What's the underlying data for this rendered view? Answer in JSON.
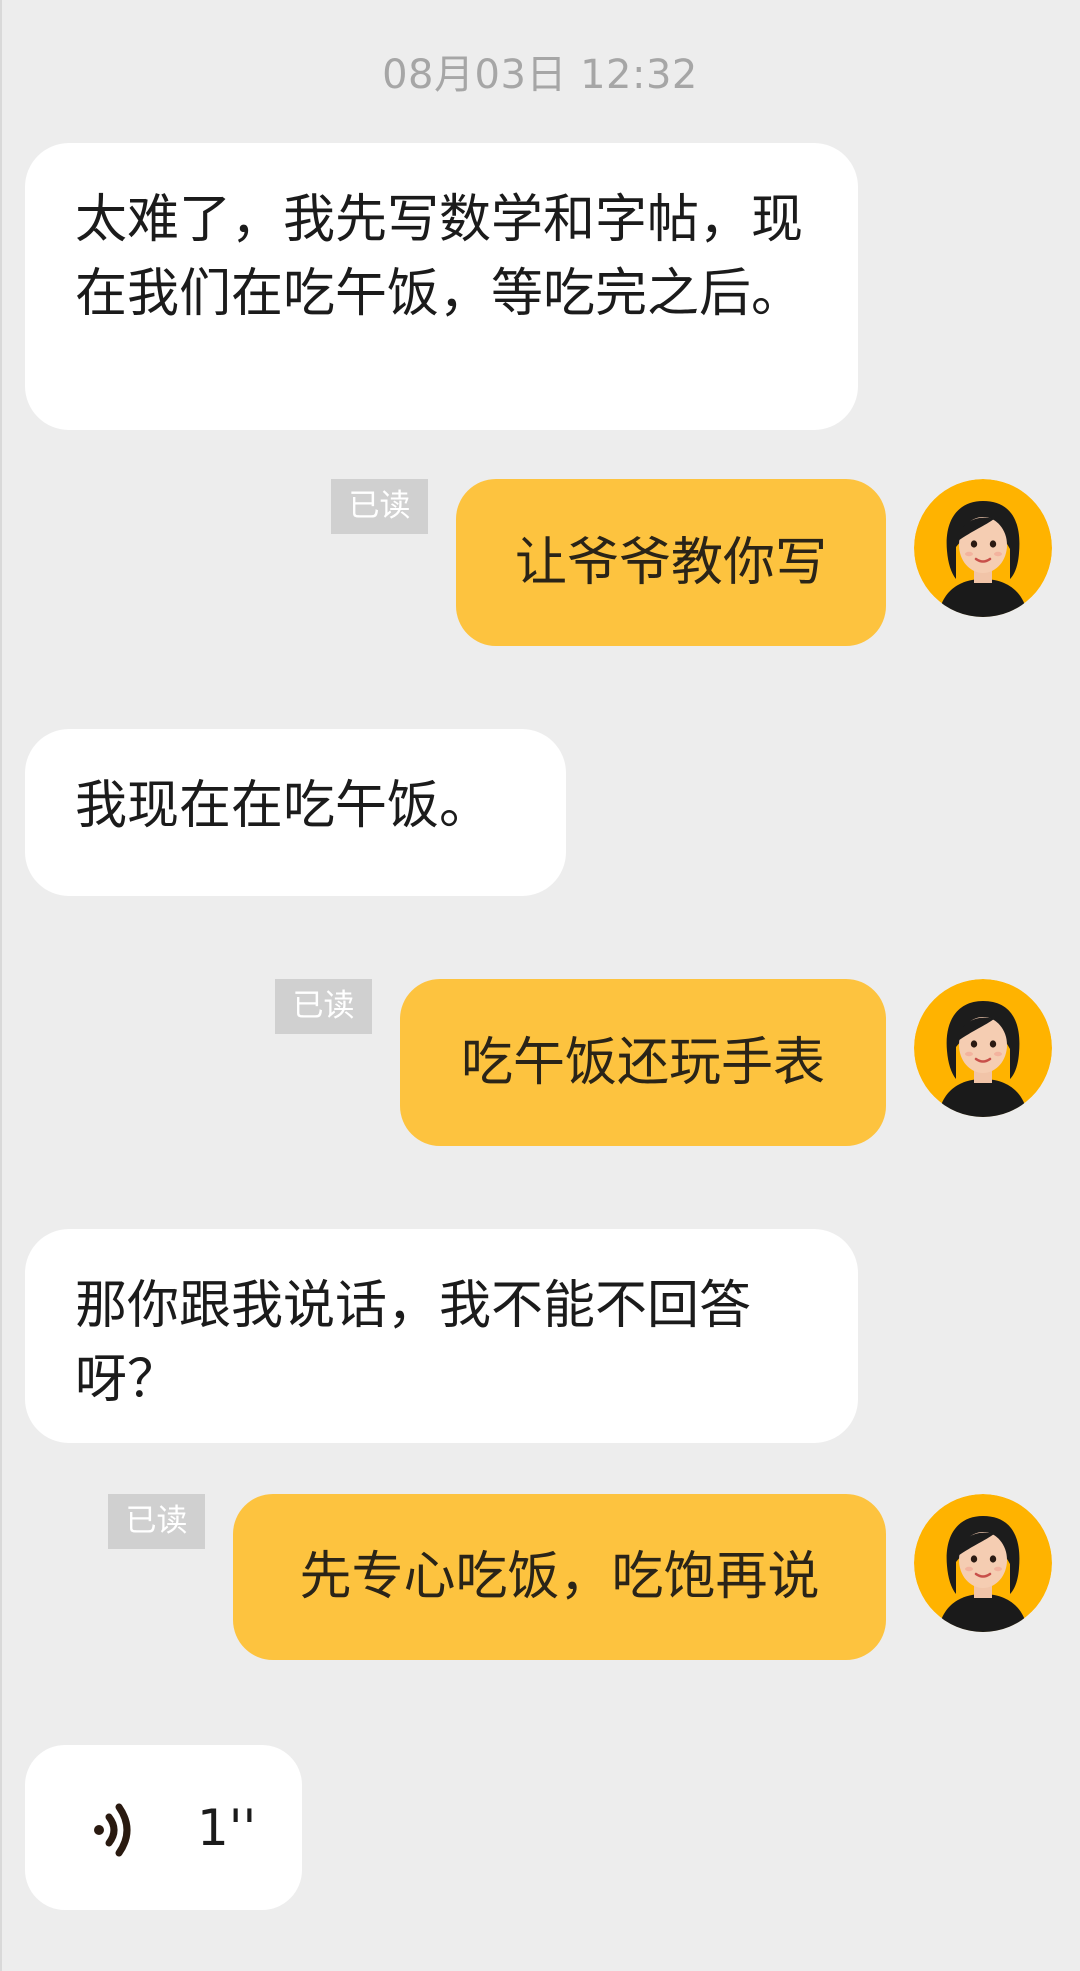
{
  "chat": {
    "timestamp": "08月03日 12:32",
    "messages": [
      {
        "side": "in",
        "text": "太难了，我先写数学和字帖，现在我们在吃午饭，等吃完之后。"
      },
      {
        "side": "out",
        "text": "让爷爷教你写",
        "read_label": "已读"
      },
      {
        "side": "in",
        "text": "我现在在吃午饭。"
      },
      {
        "side": "out",
        "text": "吃午饭还玩手表",
        "read_label": "已读"
      },
      {
        "side": "in",
        "text": "那你跟我说话，我不能不回答呀？"
      },
      {
        "side": "out",
        "text": "先专心吃饭，吃饱再说",
        "read_label": "已读"
      },
      {
        "side": "in",
        "type": "voice",
        "duration": "1''",
        "icon": "voice-wave-icon"
      }
    ]
  },
  "colors": {
    "background": "#ededed",
    "incoming_bubble": "#ffffff",
    "outgoing_bubble": "#fdc33f",
    "read_tag": "#d0d0d0",
    "avatar_ring": "#ffb300"
  }
}
